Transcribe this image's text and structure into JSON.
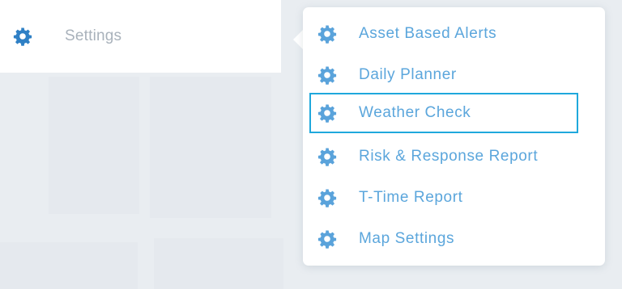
{
  "sidebar": {
    "settings": {
      "label": "Settings",
      "icon": "gear-icon"
    }
  },
  "menu": {
    "selected_index": 2,
    "items": [
      {
        "label": "Asset Based Alerts",
        "icon": "gear-icon"
      },
      {
        "label": "Daily Planner",
        "icon": "gear-icon"
      },
      {
        "label": "Weather Check",
        "icon": "gear-icon"
      },
      {
        "label": "Risk & Response Report",
        "icon": "gear-icon"
      },
      {
        "label": "T-Time Report",
        "icon": "gear-icon"
      },
      {
        "label": "Map Settings",
        "icon": "gear-icon"
      }
    ]
  },
  "colors": {
    "sidebar_icon": "#2f80c5",
    "sidebar_text": "#a9b2bb",
    "menu_icon": "#5aa3db",
    "menu_text": "#5ba6dc",
    "selection_border": "#1fa8dc",
    "background": "#e9edf1"
  }
}
